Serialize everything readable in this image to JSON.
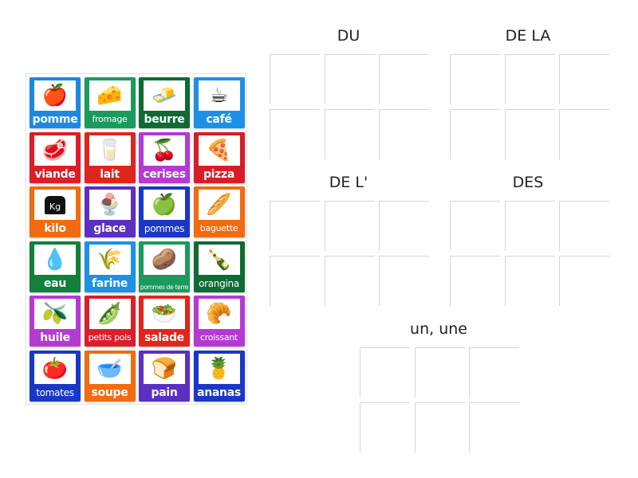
{
  "cards": [
    {
      "label": "pomme",
      "color": "#1e88e0",
      "icon": "apple-icon",
      "glyph": "🍎"
    },
    {
      "label": "fromage",
      "color": "#1a9a5c",
      "icon": "cheese-icon",
      "glyph": "🧀",
      "size": "small"
    },
    {
      "label": "beurre",
      "color": "#0f6b33",
      "icon": "butter-icon",
      "glyph": "🧈"
    },
    {
      "label": "café",
      "color": "#1e8fe6",
      "icon": "coffee-icon",
      "glyph": "☕"
    },
    {
      "label": "viande",
      "color": "#dc1e2a",
      "icon": "meat-icon",
      "glyph": "🥩"
    },
    {
      "label": "lait",
      "color": "#e0251c",
      "icon": "milk-icon",
      "glyph": "🥛"
    },
    {
      "label": "cerises",
      "color": "#b43ad2",
      "icon": "cherries-icon",
      "glyph": "🍒"
    },
    {
      "label": "pizza",
      "color": "#d81d2a",
      "icon": "pizza-icon",
      "glyph": "🍕"
    },
    {
      "label": "kilo",
      "color": "#f26b0f",
      "icon": "kilo-weight-icon",
      "glyph": "Kg"
    },
    {
      "label": "glace",
      "color": "#5a2fc2",
      "icon": "ice-cream-icon",
      "glyph": "🍨"
    },
    {
      "label": "pommes",
      "color": "#1a37c8",
      "icon": "apples-icon",
      "glyph": "🍏",
      "size": "mid"
    },
    {
      "label": "baguette",
      "color": "#f26b0f",
      "icon": "baguette-icon",
      "glyph": "🥖",
      "size": "small"
    },
    {
      "label": "eau",
      "color": "#11803a",
      "icon": "water-icon",
      "glyph": "💧"
    },
    {
      "label": "farine",
      "color": "#1e90e6",
      "icon": "flour-icon",
      "glyph": "🌾"
    },
    {
      "label": "pommes de terre",
      "color": "#1a9a5c",
      "icon": "potatoes-icon",
      "glyph": "🥔",
      "size": "tiny"
    },
    {
      "label": "orangina",
      "color": "#0f6b33",
      "icon": "orangina-bottle-icon",
      "glyph": "🍾",
      "size": "mid"
    },
    {
      "label": "huile",
      "color": "#b43ad2",
      "icon": "oil-icon",
      "glyph": "🫒"
    },
    {
      "label": "petits pois",
      "color": "#dc1e2a",
      "icon": "peas-icon",
      "glyph": "🫛",
      "size": "small"
    },
    {
      "label": "salade",
      "color": "#e0251c",
      "icon": "salad-icon",
      "glyph": "🥗"
    },
    {
      "label": "croissant",
      "color": "#b43ad2",
      "icon": "croissant-icon",
      "glyph": "🥐",
      "size": "small"
    },
    {
      "label": "tomates",
      "color": "#1a37c8",
      "icon": "tomatoes-icon",
      "glyph": "🍅",
      "size": "mid"
    },
    {
      "label": "soupe",
      "color": "#f26b0f",
      "icon": "soup-icon",
      "glyph": "🥣"
    },
    {
      "label": "pain",
      "color": "#5a2fc2",
      "icon": "bread-icon",
      "glyph": "🍞"
    },
    {
      "label": "ananas",
      "color": "#1a37c8",
      "icon": "pineapple-icon",
      "glyph": "🍍"
    }
  ],
  "groups": [
    {
      "title": "DU",
      "slots": 6
    },
    {
      "title": "DE LA",
      "slots": 6
    },
    {
      "title": "DE L'",
      "slots": 6
    },
    {
      "title": "DES",
      "slots": 6
    },
    {
      "title": "un, une",
      "slots": 6
    }
  ]
}
